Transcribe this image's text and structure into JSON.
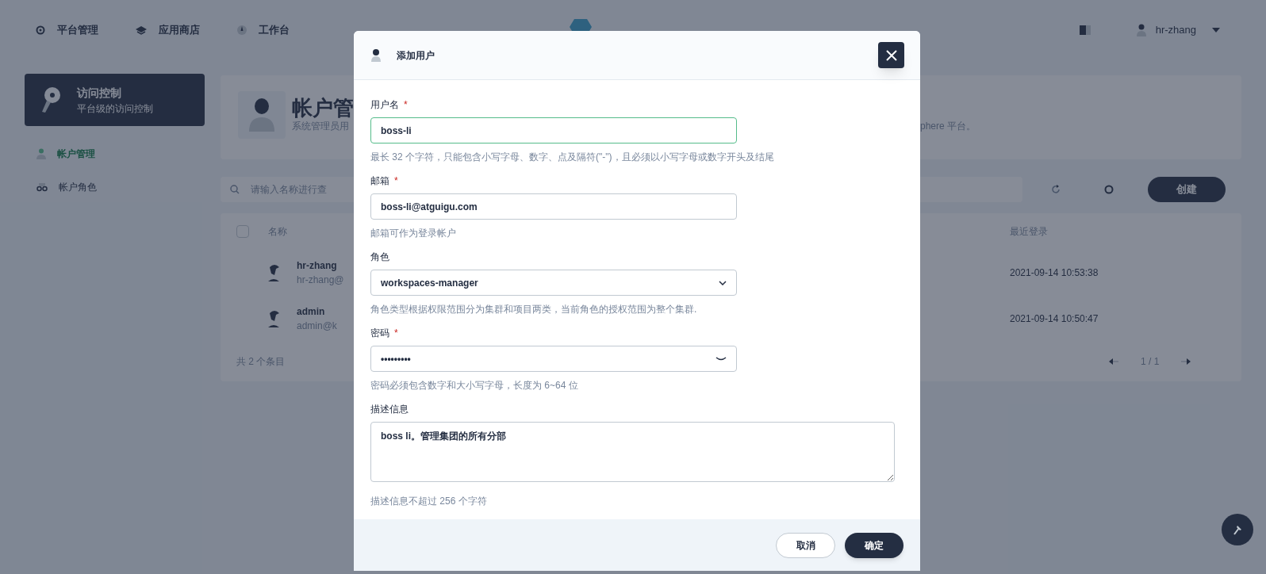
{
  "top_nav": {
    "items": [
      {
        "label": "平台管理"
      },
      {
        "label": "应用商店"
      },
      {
        "label": "工作台"
      }
    ],
    "user": "hr-zhang"
  },
  "sidebar": {
    "card": {
      "title": "访问控制",
      "subtitle": "平台级的访问控制"
    },
    "items": [
      {
        "label": "帐户管理",
        "selected": true
      },
      {
        "label": "帐户角色",
        "selected": false
      }
    ]
  },
  "banner": {
    "title": "帐户管",
    "description_left": "系统管理员用",
    "description_right": "phere 平台。"
  },
  "toolbar": {
    "search_placeholder": "请输入名称进行查",
    "create_button": "创建"
  },
  "table": {
    "columns": [
      "名称",
      "最近登录"
    ],
    "rows": [
      {
        "name": "hr-zhang",
        "email": "hr-zhang@",
        "last_login": "2021-09-14 10:53:38"
      },
      {
        "name": "admin",
        "email": "admin@k",
        "last_login": "2021-09-14 10:50:47"
      }
    ],
    "select_all_checked": false,
    "total": "共 2 个条目",
    "page": "1 / 1"
  },
  "dialog": {
    "title": "添加用户",
    "fields": [
      {
        "kind": "text",
        "label": "用户名",
        "mark": "*",
        "value": "boss-li",
        "focused": true,
        "hint": "最长 32 个字符，只能包含小写字母、数字、点及隔符(\"-\")，且必须以小写字母或数字开头及结尾"
      },
      {
        "kind": "text",
        "label": "邮箱",
        "mark": "*",
        "value": "boss-li@atguigu.com",
        "focused": false,
        "hint": "邮箱可作为登录帐户"
      },
      {
        "kind": "select",
        "label": "角色",
        "value": "workspaces-manager",
        "focused": false,
        "hint": "角色类型根据权限范围分为集群和项目两类，当前角色的授权范围为整个集群."
      },
      {
        "kind": "password",
        "label": "密码",
        "mark": "*",
        "value": "•••••••••",
        "focused": false,
        "hint": "密码必须包含数字和大小写字母，长度为 6~64 位"
      },
      {
        "kind": "textarea",
        "label": "描述信息",
        "value": "boss li。管理集团的所有分部",
        "focused": false,
        "hint": "描述信息不超过 256 个字符"
      }
    ],
    "buttons": {
      "cancel": "取消",
      "confirm": "确定"
    }
  }
}
